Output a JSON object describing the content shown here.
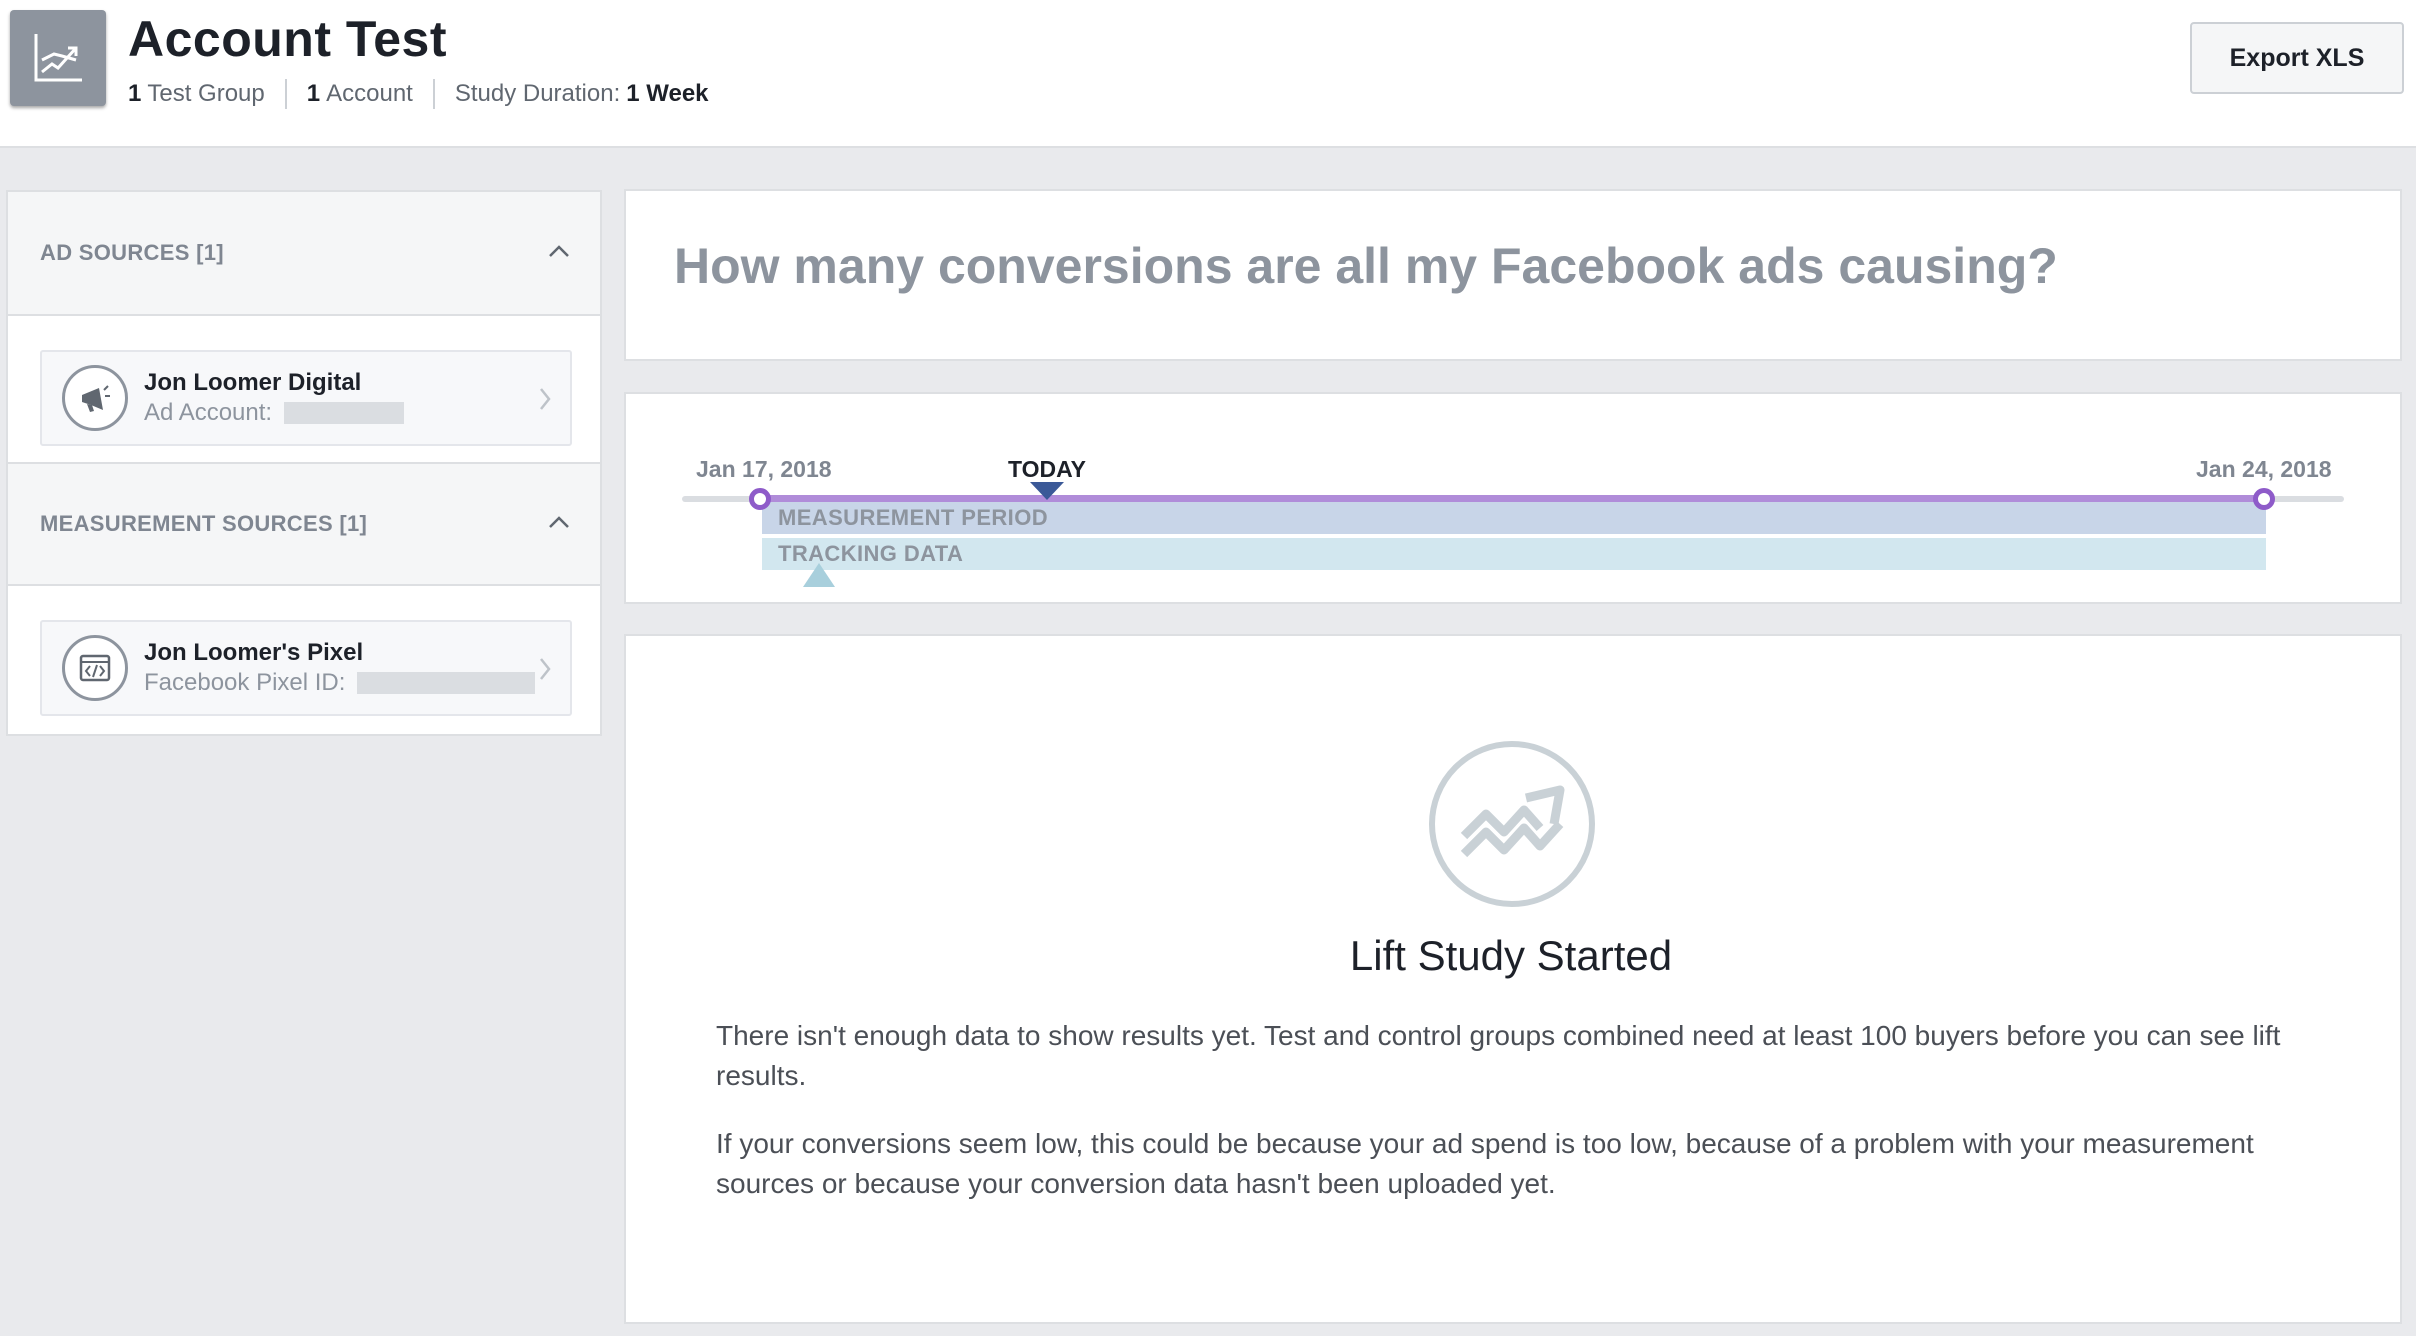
{
  "header": {
    "title": "Account Test",
    "test_groups": {
      "count": "1",
      "label": "Test Group"
    },
    "accounts": {
      "count": "1",
      "label": "Account"
    },
    "duration": {
      "label": "Study Duration:",
      "value": "1 Week"
    },
    "export_label": "Export XLS",
    "icon": "line-chart-icon"
  },
  "sidebar": {
    "ad_sources": {
      "title": "AD SOURCES [1]",
      "items": [
        {
          "name": "Jon Loomer Digital",
          "sub_label": "Ad Account:",
          "icon": "megaphone-icon"
        }
      ]
    },
    "measurement_sources": {
      "title": "MEASUREMENT SOURCES [1]",
      "items": [
        {
          "name": "Jon Loomer's Pixel",
          "sub_label": "Facebook Pixel ID:",
          "icon": "code-icon"
        }
      ]
    }
  },
  "question": "How many conversions are all my Facebook ads causing?",
  "timeline": {
    "start_date": "Jan 17, 2018",
    "end_date": "Jan 24, 2018",
    "today_label": "TODAY",
    "measurement_label": "MEASUREMENT PERIOD",
    "tracking_label": "TRACKING DATA"
  },
  "result": {
    "icon": "trend-chart-icon",
    "title": "Lift Study Started",
    "paragraph_1": "There isn't enough data to show results yet. Test and control groups combined need at least 100 buyers before you can see lift results.",
    "paragraph_2": "If your conversions seem low, this could be because your ad spend is too low, because of a problem with your measurement sources or because your conversion data hasn't been uploaded yet."
  },
  "colors": {
    "accent_purple": "#8e5bc9",
    "today_marker": "#3b5998",
    "measurement_bar": "#c8d5e8",
    "tracking_bar": "#d2e7ef"
  }
}
